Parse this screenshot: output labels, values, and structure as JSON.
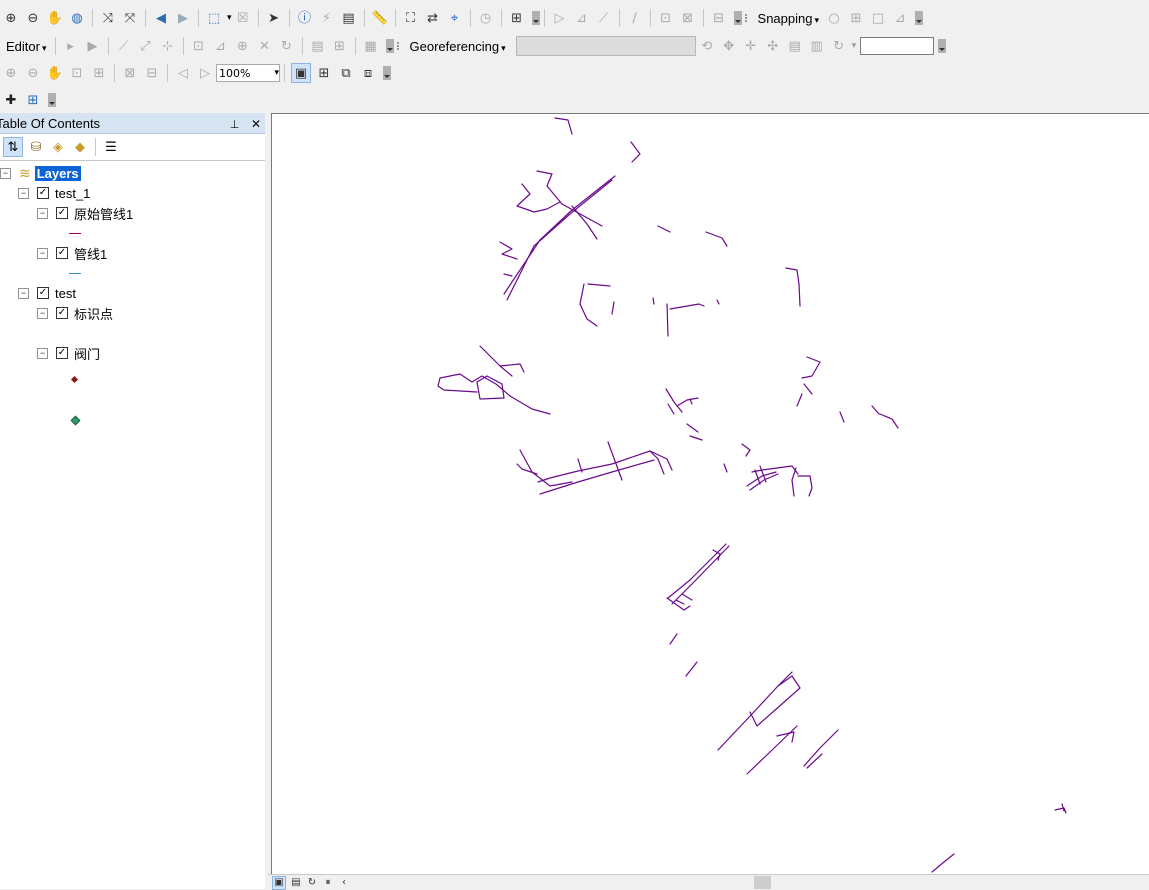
{
  "toolbar": {
    "editor_label": "Editor",
    "snapping_label": "Snapping",
    "georeferencing_label": "Georeferencing",
    "zoom_percent": "100%",
    "georef_layer_value": "",
    "rotate_value": ""
  },
  "toc": {
    "title": "Table Of Contents",
    "pin_glyph": "⮟",
    "close_glyph": "✕",
    "root_label": "Layers",
    "groups": [
      {
        "label": "test_1",
        "layers": [
          {
            "label": "原始管线1",
            "symbol": "line",
            "color": "#a0006b"
          },
          {
            "label": "管线1",
            "symbol": "line",
            "color": "#2e8fd8"
          }
        ]
      },
      {
        "label": "test",
        "layers": [
          {
            "label": "标识点",
            "symbol": "point",
            "color": "#8b1a1a"
          },
          {
            "label": "阀门",
            "symbol": "point",
            "color": "#2e9e6e"
          }
        ]
      }
    ]
  },
  "map": {
    "line_color": "#6a0a8c",
    "background": "#ffffff"
  }
}
